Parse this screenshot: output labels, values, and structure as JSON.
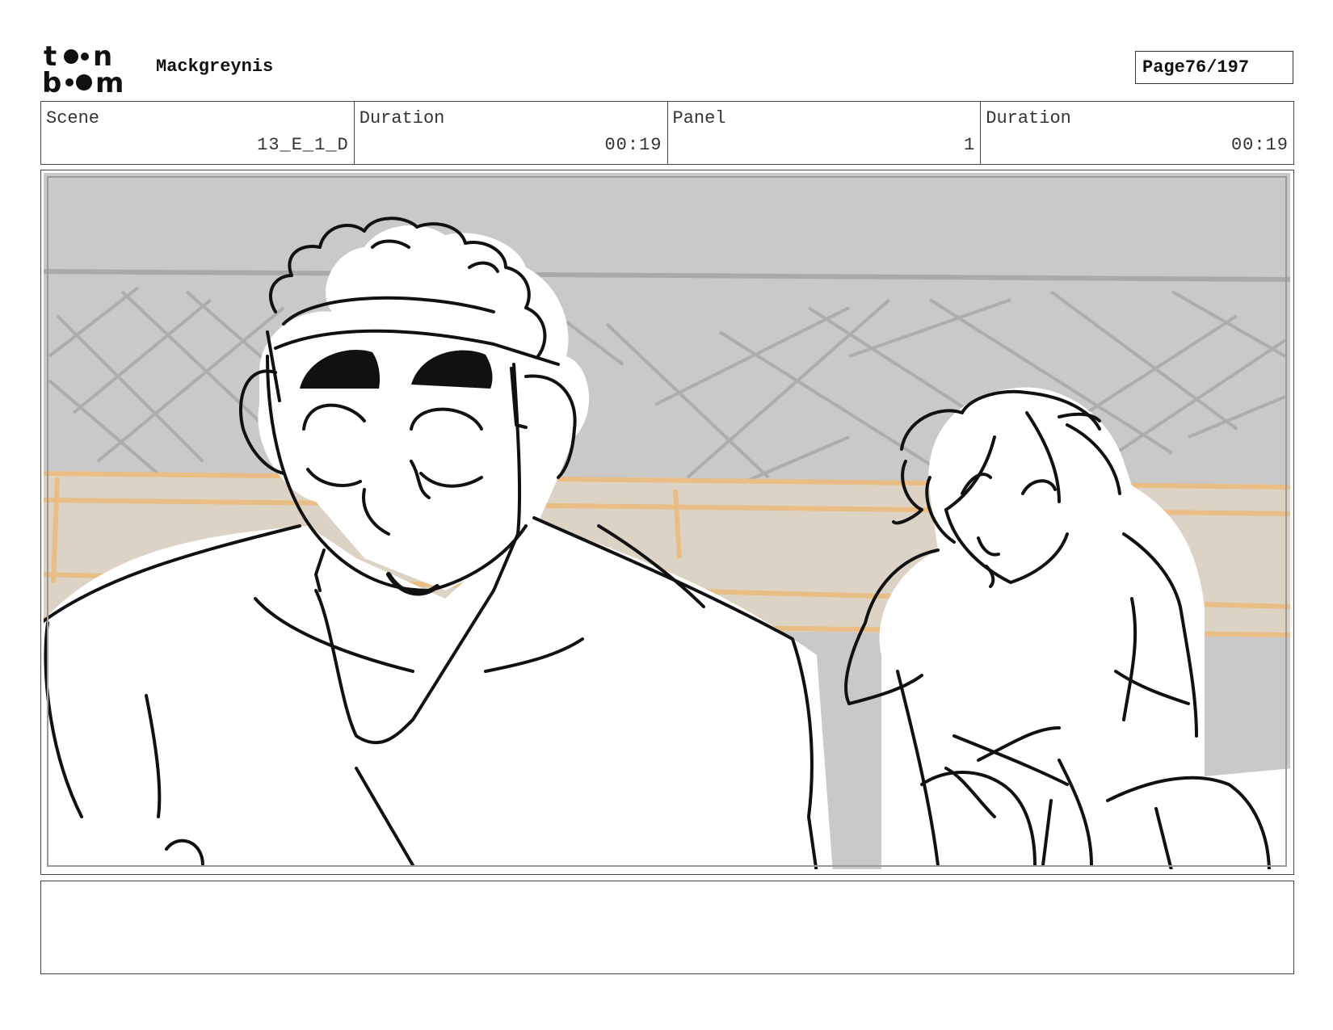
{
  "header": {
    "logo_text_top": "toon",
    "logo_text_bottom": "boom",
    "project_name": "Mackgreynis",
    "page_label": "Page",
    "page_value": "76/197"
  },
  "info": {
    "scene_label": "Scene",
    "scene_value": "13_E_1_D",
    "scene_duration_label": "Duration",
    "scene_duration_value": "00:19",
    "panel_label": "Panel",
    "panel_value": "1",
    "panel_duration_label": "Duration",
    "panel_duration_value": "00:19"
  },
  "colors": {
    "background_gray": "#c9c9c9",
    "bench_tan": "#ddd3c4",
    "bench_stroke": "#e9bd83",
    "line": "#111111"
  },
  "notes": {
    "text": ""
  }
}
